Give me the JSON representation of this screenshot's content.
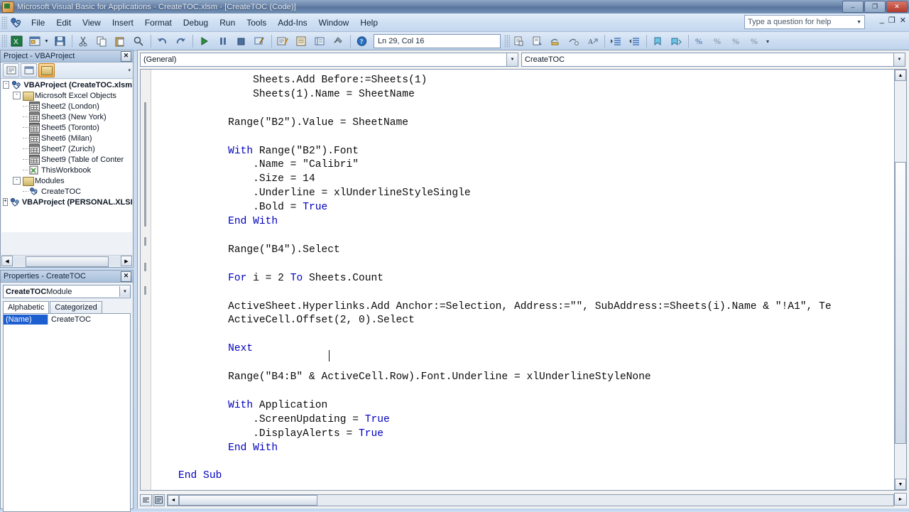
{
  "window": {
    "title": "Microsoft Visual Basic for Applications - CreateTOC.xlsm - [CreateTOC (Code)]",
    "minimize": "–",
    "restore": "❐",
    "close": "✕"
  },
  "menubar": {
    "items": [
      "File",
      "Edit",
      "View",
      "Insert",
      "Format",
      "Debug",
      "Run",
      "Tools",
      "Add-Ins",
      "Window",
      "Help"
    ],
    "help_placeholder": "Type a question for help",
    "mdi_minimize": "_",
    "mdi_restore": "❐",
    "mdi_close": "✕"
  },
  "toolbar": {
    "position_indicator": "Ln 29, Col 16",
    "buttons": [
      "view-excel-icon",
      "insert-userform-icon",
      "save-icon",
      "cut-icon",
      "copy-icon",
      "paste-icon",
      "find-icon",
      "undo-icon",
      "redo-icon",
      "run-icon",
      "break-icon",
      "reset-icon",
      "design-mode-icon",
      "project-explorer-icon",
      "properties-window-icon",
      "object-browser-icon",
      "toolbox-icon",
      "help-icon"
    ],
    "buttons_right": [
      "list-properties-icon",
      "list-constants-icon",
      "quick-info-icon",
      "parameter-info-icon",
      "complete-word-icon",
      "indent-icon",
      "outdent-icon",
      "toggle-bookmark-icon",
      "next-bookmark-icon",
      "comment-block-icon",
      "uncomment-block-icon",
      "toggle-breakpoint-icon",
      "clear-bookmarks-icon"
    ]
  },
  "project_explorer": {
    "title": "Project - VBAProject",
    "close_label": "✕",
    "toolbar_buttons": [
      "view-code-icon",
      "view-object-icon",
      "toggle-folders-icon"
    ],
    "tree": [
      {
        "depth": 0,
        "expander": "-",
        "icon": "vbaproject-icon",
        "label": "VBAProject (CreateTOC.xlsm",
        "bold": true
      },
      {
        "depth": 1,
        "expander": "-",
        "icon": "folder-icon",
        "label": "Microsoft Excel Objects",
        "bold": false
      },
      {
        "depth": 2,
        "expander": "",
        "icon": "sheet-icon",
        "label": "Sheet2 (London)",
        "bold": false
      },
      {
        "depth": 2,
        "expander": "",
        "icon": "sheet-icon",
        "label": "Sheet3 (New York)",
        "bold": false
      },
      {
        "depth": 2,
        "expander": "",
        "icon": "sheet-icon",
        "label": "Sheet5 (Toronto)",
        "bold": false
      },
      {
        "depth": 2,
        "expander": "",
        "icon": "sheet-icon",
        "label": "Sheet6 (Milan)",
        "bold": false
      },
      {
        "depth": 2,
        "expander": "",
        "icon": "sheet-icon",
        "label": "Sheet7 (Zurich)",
        "bold": false
      },
      {
        "depth": 2,
        "expander": "",
        "icon": "sheet-icon",
        "label": "Sheet9 (Table of Conter",
        "bold": false
      },
      {
        "depth": 2,
        "expander": "",
        "icon": "workbook-icon",
        "label": "ThisWorkbook",
        "bold": false
      },
      {
        "depth": 1,
        "expander": "-",
        "icon": "folder-icon",
        "label": "Modules",
        "bold": false
      },
      {
        "depth": 2,
        "expander": "",
        "icon": "module-icon",
        "label": "CreateTOC",
        "bold": false
      },
      {
        "depth": 0,
        "expander": "+",
        "icon": "vbaproject-icon",
        "label": "VBAProject (PERSONAL.XLSI",
        "bold": true
      }
    ]
  },
  "properties": {
    "title": "Properties - CreateTOC",
    "close_label": "✕",
    "object_bold": "CreateTOC",
    "object_type": " Module",
    "tabs": [
      "Alphabetic",
      "Categorized"
    ],
    "selected_tab": "Alphabetic",
    "rows": [
      {
        "name": "(Name)",
        "value": "CreateTOC"
      }
    ]
  },
  "code_window": {
    "object_combo": "(General)",
    "procedure_combo": "CreateTOC",
    "combo_arrow": "▼",
    "view_buttons": [
      "procedure-view-icon",
      "full-module-view-icon"
    ],
    "scroll_up": "▲",
    "scroll_down": "▼",
    "scroll_left": "◄",
    "scroll_right": "►",
    "lines": [
      {
        "indent": 4,
        "segments": [
          {
            "t": "Sheets.Add Before:=Sheets(1)",
            "k": false
          }
        ]
      },
      {
        "indent": 4,
        "segments": [
          {
            "t": "Sheets(1).Name = SheetName",
            "k": false
          }
        ]
      },
      {
        "indent": 0,
        "segments": []
      },
      {
        "indent": 3,
        "segments": [
          {
            "t": "Range(\"B2\").Value = SheetName",
            "k": false
          }
        ]
      },
      {
        "indent": 0,
        "segments": []
      },
      {
        "indent": 3,
        "segments": [
          {
            "t": "With",
            "k": true
          },
          {
            "t": " Range(\"B2\").Font",
            "k": false
          }
        ]
      },
      {
        "indent": 3,
        "segments": [
          {
            "t": "    .Name = \"Calibri\"",
            "k": false
          }
        ]
      },
      {
        "indent": 3,
        "segments": [
          {
            "t": "    .Size = 14",
            "k": false
          }
        ]
      },
      {
        "indent": 3,
        "segments": [
          {
            "t": "    .Underline = xlUnderlineStyleSingle",
            "k": false
          }
        ]
      },
      {
        "indent": 3,
        "segments": [
          {
            "t": "    .Bold = ",
            "k": false
          },
          {
            "t": "True",
            "k": true
          }
        ]
      },
      {
        "indent": 3,
        "segments": [
          {
            "t": "End With",
            "k": true
          }
        ]
      },
      {
        "indent": 0,
        "segments": []
      },
      {
        "indent": 3,
        "segments": [
          {
            "t": "Range(\"B4\").Select",
            "k": false
          }
        ]
      },
      {
        "indent": 0,
        "segments": []
      },
      {
        "indent": 3,
        "segments": [
          {
            "t": "For",
            "k": true
          },
          {
            "t": " i = 2 ",
            "k": false
          },
          {
            "t": "To",
            "k": true
          },
          {
            "t": " Sheets.Count",
            "k": false
          }
        ]
      },
      {
        "indent": 0,
        "segments": []
      },
      {
        "indent": 3,
        "segments": [
          {
            "t": "ActiveSheet.Hyperlinks.Add Anchor:=Selection, Address:=\"\", SubAddress:=Sheets(i).Name & \"!A1\", Te",
            "k": false
          }
        ]
      },
      {
        "indent": 3,
        "segments": [
          {
            "t": "ActiveCell.Offset(2, 0).Select",
            "k": false
          }
        ]
      },
      {
        "indent": 0,
        "segments": []
      },
      {
        "indent": 3,
        "segments": [
          {
            "t": "Next",
            "k": true
          }
        ]
      },
      {
        "indent": 0,
        "segments": []
      },
      {
        "indent": 3,
        "segments": [
          {
            "t": "Range(\"B4:B\" & ActiveCell.Row).Font.Underline = xlUnderlineStyleNone",
            "k": false
          }
        ]
      },
      {
        "indent": 0,
        "segments": []
      },
      {
        "indent": 3,
        "segments": [
          {
            "t": "With",
            "k": true
          },
          {
            "t": " Application",
            "k": false
          }
        ]
      },
      {
        "indent": 3,
        "segments": [
          {
            "t": "    .ScreenUpdating = ",
            "k": false
          },
          {
            "t": "True",
            "k": true
          }
        ]
      },
      {
        "indent": 3,
        "segments": [
          {
            "t": "    .DisplayAlerts = ",
            "k": false
          },
          {
            "t": "True",
            "k": true
          }
        ]
      },
      {
        "indent": 3,
        "segments": [
          {
            "t": "End With",
            "k": true
          }
        ]
      },
      {
        "indent": 0,
        "segments": []
      },
      {
        "indent": 1,
        "segments": [
          {
            "t": "End Sub",
            "k": true
          }
        ]
      }
    ]
  },
  "colors": {
    "keyword": "#0000C0",
    "code_text": "#0B0B0B",
    "selection_blue": "#1D5FD0",
    "titlebar": "#6D87AB"
  }
}
